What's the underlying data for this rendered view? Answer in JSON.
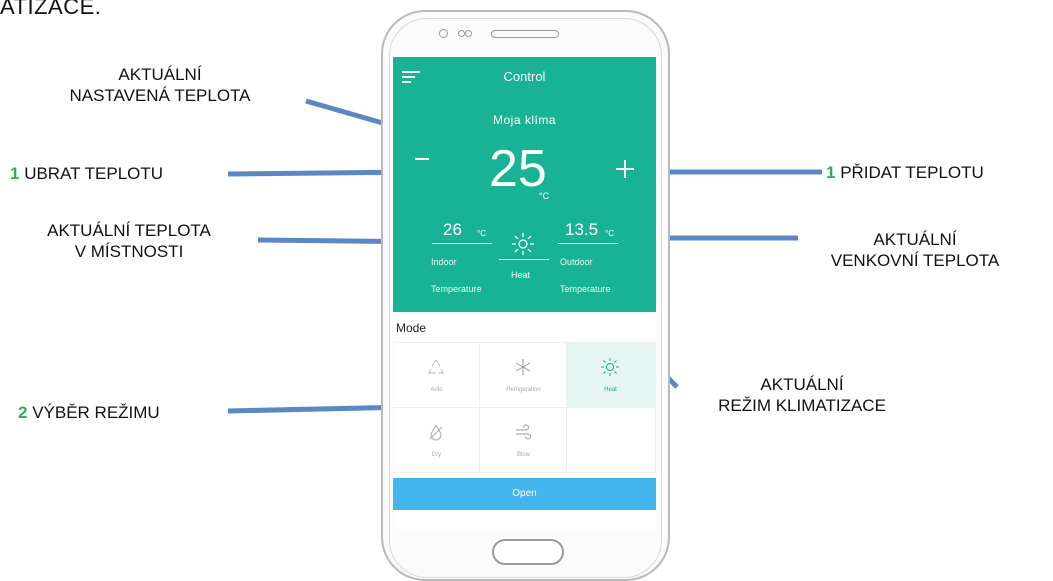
{
  "heading": "ATIZACE.",
  "labels": {
    "set_temp": "AKTUÁLNÍ\nNASTAVENÁ TEPLOTA",
    "decrease_num": "1",
    "decrease_text": " UBRAT TEPLOTU",
    "increase_num": "1",
    "increase_text": " PŘIDAT TEPLOTU",
    "room_temp": "AKTUÁLNÍ TEPLOTA\nV MÍSTNOSTI",
    "outdoor_temp": "AKTUÁLNÍ\nVENKOVNÍ TEPLOTA",
    "mode_select_num": "2",
    "mode_select_text": " VÝBĚR REŽIMU",
    "current_mode": "AKTUÁLNÍ\nREŽIM KLIMATIZACE"
  },
  "app": {
    "title": "Control",
    "device_name": "Moja klíma",
    "set_temperature": "25",
    "set_unit": "°C",
    "indoor": {
      "value": "26",
      "unit": "°C",
      "label1": "Indoor",
      "label2": "Temperature"
    },
    "outdoor": {
      "value": "13.5",
      "unit": "°C",
      "label1": "Outdoor",
      "label2": "Temperature"
    },
    "current_mode": "Heat",
    "mode_title": "Mode",
    "modes": [
      {
        "label": "Auto",
        "icon": "recycle-icon",
        "active": false
      },
      {
        "label": "Refrigeration",
        "icon": "snowflake-icon",
        "active": false
      },
      {
        "label": "Heat",
        "icon": "sun-icon",
        "active": true
      },
      {
        "label": "Dry",
        "icon": "drop-slash-icon",
        "active": false
      },
      {
        "label": "Blow",
        "icon": "wind-icon",
        "active": false
      }
    ],
    "open_button": "Open"
  },
  "colors": {
    "panel": "#18b394",
    "connector": "#5b87c4",
    "number_accent": "#2bb24c",
    "open_button": "#43b4ec",
    "active_mode_bg": "#e5f6f2"
  }
}
